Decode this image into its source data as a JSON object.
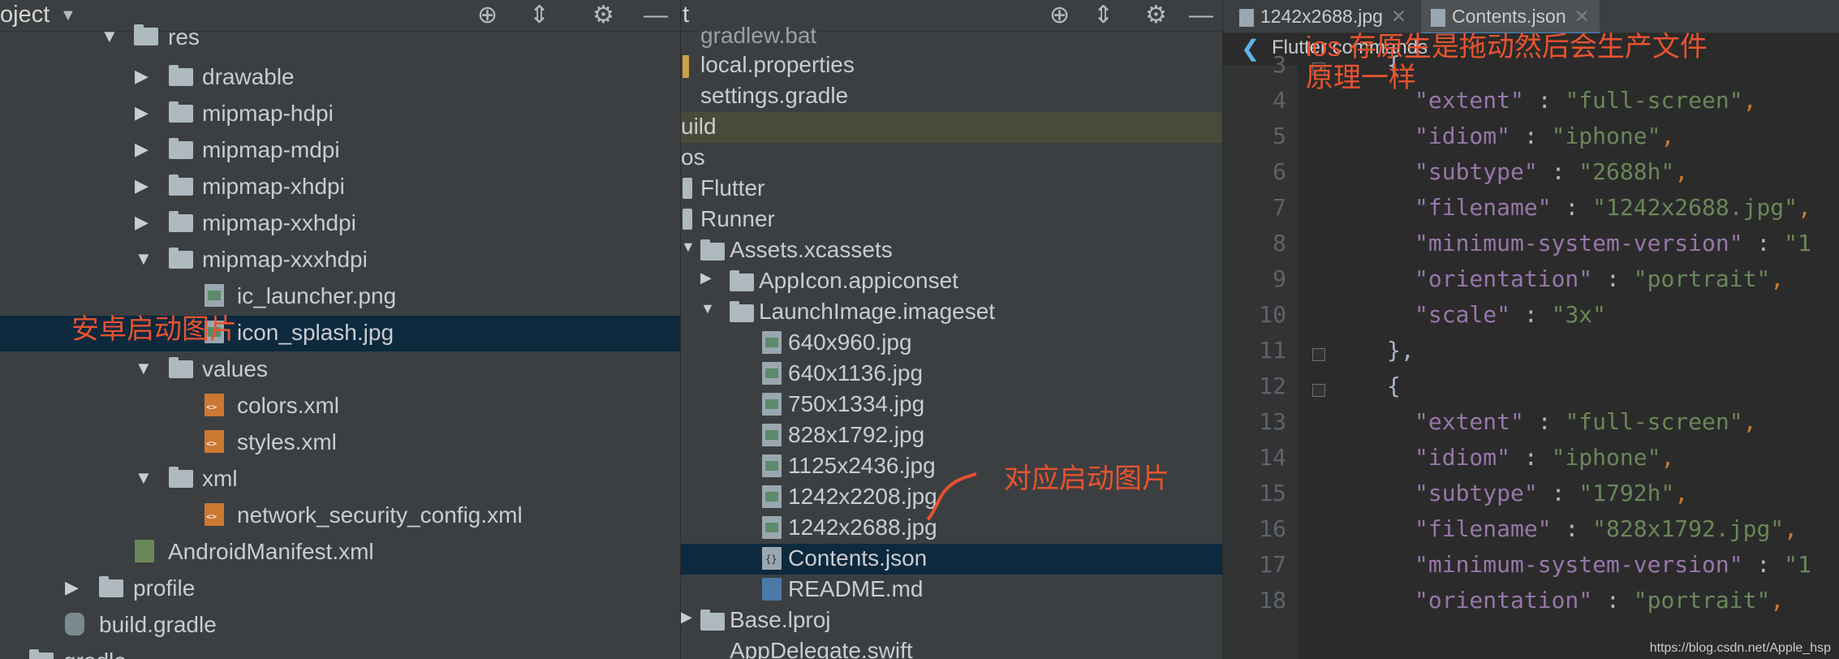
{
  "left_panel": {
    "title": "oject",
    "items": [
      {
        "label": "res"
      },
      {
        "label": "drawable"
      },
      {
        "label": "mipmap-hdpi"
      },
      {
        "label": "mipmap-mdpi"
      },
      {
        "label": "mipmap-xhdpi"
      },
      {
        "label": "mipmap-xxhdpi"
      },
      {
        "label": "mipmap-xxxhdpi"
      },
      {
        "label": "ic_launcher.png"
      },
      {
        "label": "icon_splash.jpg"
      },
      {
        "label": "values"
      },
      {
        "label": "colors.xml"
      },
      {
        "label": "styles.xml"
      },
      {
        "label": "xml"
      },
      {
        "label": "network_security_config.xml"
      },
      {
        "label": "AndroidManifest.xml"
      },
      {
        "label": "profile"
      },
      {
        "label": "build.gradle"
      },
      {
        "label": "gradle"
      }
    ],
    "annotation": "安卓启动图片"
  },
  "middle_panel": {
    "title": "t",
    "items": [
      {
        "label": "gradlew.bat"
      },
      {
        "label": "local.properties"
      },
      {
        "label": "settings.gradle"
      },
      {
        "label": "uild"
      },
      {
        "label": "os"
      },
      {
        "label": "Flutter"
      },
      {
        "label": "Runner"
      },
      {
        "label": "Assets.xcassets"
      },
      {
        "label": "AppIcon.appiconset"
      },
      {
        "label": "LaunchImage.imageset"
      },
      {
        "label": "640x960.jpg"
      },
      {
        "label": "640x1136.jpg"
      },
      {
        "label": "750x1334.jpg"
      },
      {
        "label": "828x1792.jpg"
      },
      {
        "label": "1125x2436.jpg"
      },
      {
        "label": "1242x2208.jpg"
      },
      {
        "label": "1242x2688.jpg"
      },
      {
        "label": "Contents.json"
      },
      {
        "label": "README.md"
      },
      {
        "label": "Base.lproj"
      },
      {
        "label": "AppDelegate.swift"
      }
    ],
    "annotation": "对应启动图片"
  },
  "editor": {
    "tabs": [
      {
        "label": "1242x2688.jpg"
      },
      {
        "label": "Contents.json"
      }
    ],
    "breadcrumb": "Flutter commands",
    "annotation_line1": "ios 存原生是拖动然后会生产文件",
    "annotation_line2": "原理一样",
    "line_numbers": [
      "3",
      "4",
      "5",
      "6",
      "7",
      "8",
      "9",
      "10",
      "11",
      "12",
      "13",
      "14",
      "15",
      "16",
      "17",
      "18"
    ],
    "code": [
      {
        "key": "",
        "value": "",
        "raw": "{"
      },
      {
        "key": "\"extent\"",
        "value": "\"full-screen\"",
        "raw": ""
      },
      {
        "key": "\"idiom\"",
        "value": "\"iphone\"",
        "raw": ""
      },
      {
        "key": "\"subtype\"",
        "value": "\"2688h\"",
        "raw": ""
      },
      {
        "key": "\"filename\"",
        "value": "\"1242x2688.jpg\"",
        "raw": ""
      },
      {
        "key": "\"minimum-system-version\"",
        "value": "\"1",
        "raw": ""
      },
      {
        "key": "\"orientation\"",
        "value": "\"portrait\"",
        "raw": ""
      },
      {
        "key": "\"scale\"",
        "value": "\"3x\"",
        "raw": ""
      },
      {
        "key": "",
        "value": "",
        "raw": "},"
      },
      {
        "key": "",
        "value": "",
        "raw": "{"
      },
      {
        "key": "\"extent\"",
        "value": "\"full-screen\"",
        "raw": ""
      },
      {
        "key": "\"idiom\"",
        "value": "\"iphone\"",
        "raw": ""
      },
      {
        "key": "\"subtype\"",
        "value": "\"1792h\"",
        "raw": ""
      },
      {
        "key": "\"filename\"",
        "value": "\"828x1792.jpg\"",
        "raw": ""
      },
      {
        "key": "\"minimum-system-version\"",
        "value": "\"1",
        "raw": ""
      },
      {
        "key": "\"orientation\"",
        "value": "\"portrait\"",
        "raw": ""
      }
    ],
    "colon": " : ",
    "comma": ","
  },
  "watermark": "https://blog.csdn.net/Apple_hsp",
  "colors": {
    "accent_annotation": "#e8532f",
    "selection": "#0d293e",
    "string": "#6a8759",
    "key": "#9876aa"
  }
}
